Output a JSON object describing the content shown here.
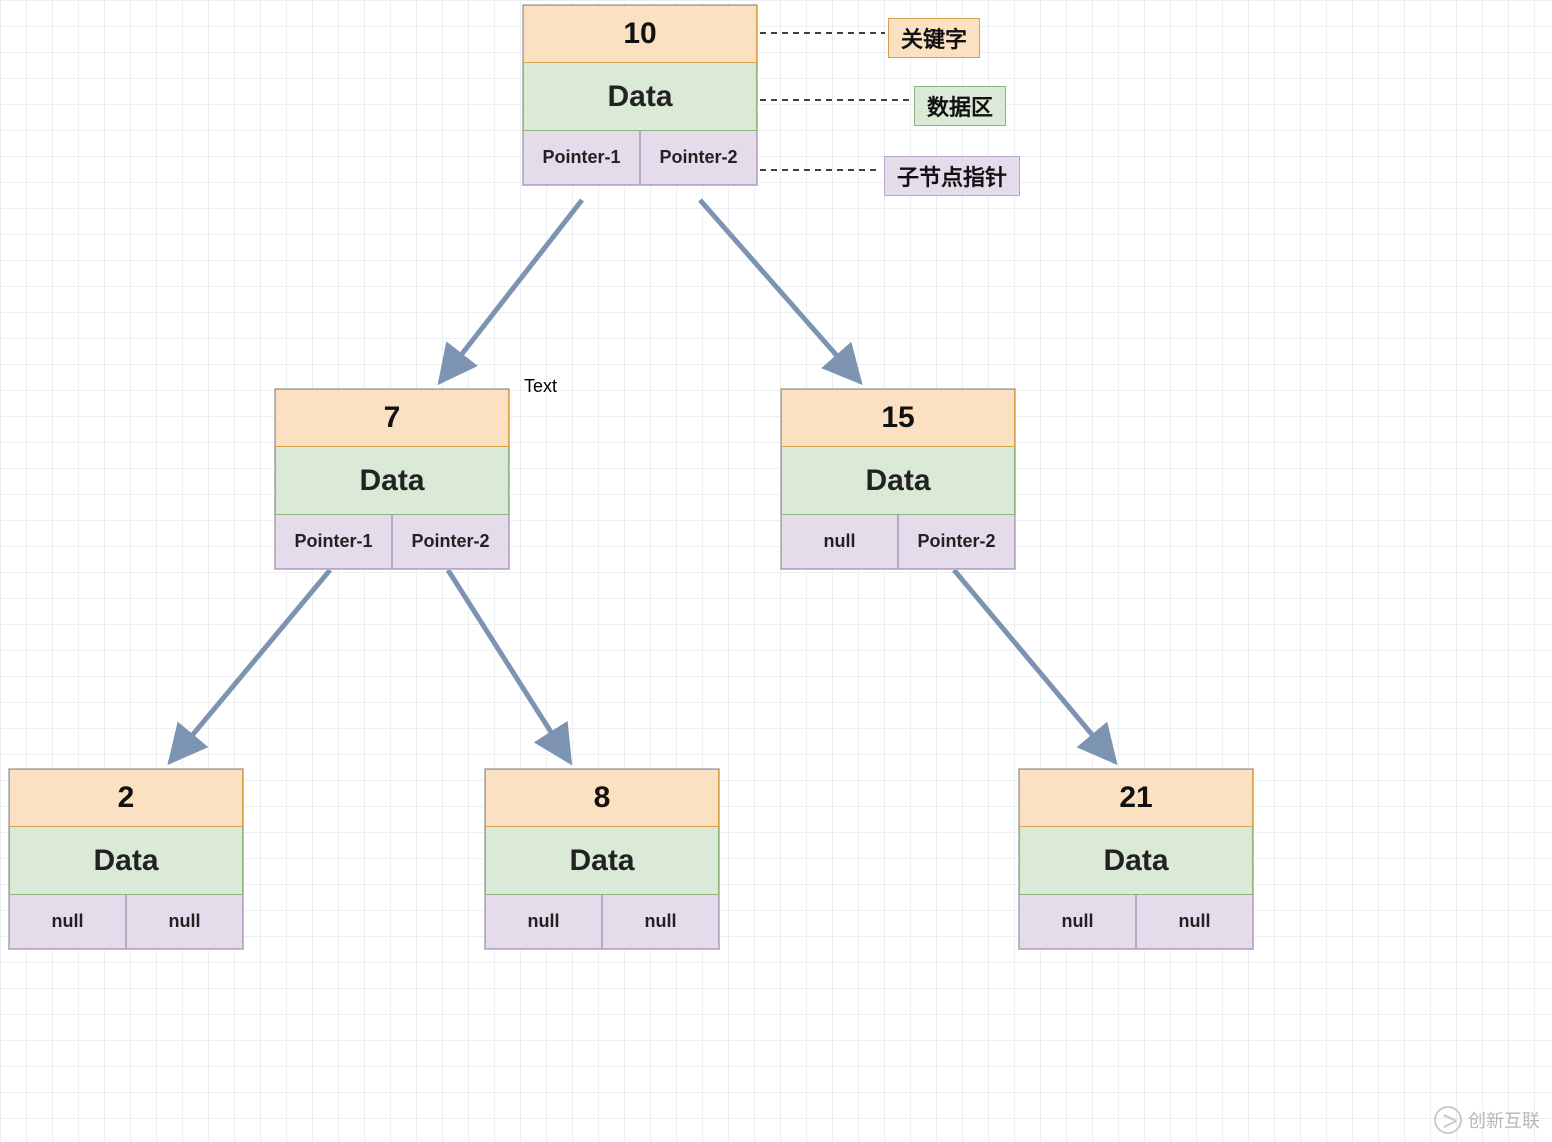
{
  "legend": {
    "key": "关键字",
    "data": "数据区",
    "pointer": "子节点指针"
  },
  "free_text": "Text",
  "watermark": "创新互联",
  "nodes": {
    "root": {
      "key": "10",
      "data": "Data",
      "p1": "Pointer-1",
      "p2": "Pointer-2"
    },
    "left": {
      "key": "7",
      "data": "Data",
      "p1": "Pointer-1",
      "p2": "Pointer-2"
    },
    "right": {
      "key": "15",
      "data": "Data",
      "p1": "null",
      "p2": "Pointer-2"
    },
    "ll": {
      "key": "2",
      "data": "Data",
      "p1": "null",
      "p2": "null"
    },
    "lr": {
      "key": "8",
      "data": "Data",
      "p1": "null",
      "p2": "null"
    },
    "rr": {
      "key": "21",
      "data": "Data",
      "p1": "null",
      "p2": "null"
    }
  },
  "chart_data": {
    "type": "tree",
    "title": "",
    "node_schema": [
      "key",
      "data",
      "left_pointer",
      "right_pointer"
    ],
    "nodes": [
      {
        "id": "root",
        "key": 10,
        "data": "Data",
        "left": "left",
        "right": "right"
      },
      {
        "id": "left",
        "key": 7,
        "data": "Data",
        "left": "ll",
        "right": "lr"
      },
      {
        "id": "right",
        "key": 15,
        "data": "Data",
        "left": null,
        "right": "rr"
      },
      {
        "id": "ll",
        "key": 2,
        "data": "Data",
        "left": null,
        "right": null
      },
      {
        "id": "lr",
        "key": 8,
        "data": "Data",
        "left": null,
        "right": null
      },
      {
        "id": "rr",
        "key": 21,
        "data": "Data",
        "left": null,
        "right": null
      }
    ],
    "legend": {
      "key": "关键字",
      "data": "数据区",
      "pointer": "子节点指针"
    }
  }
}
